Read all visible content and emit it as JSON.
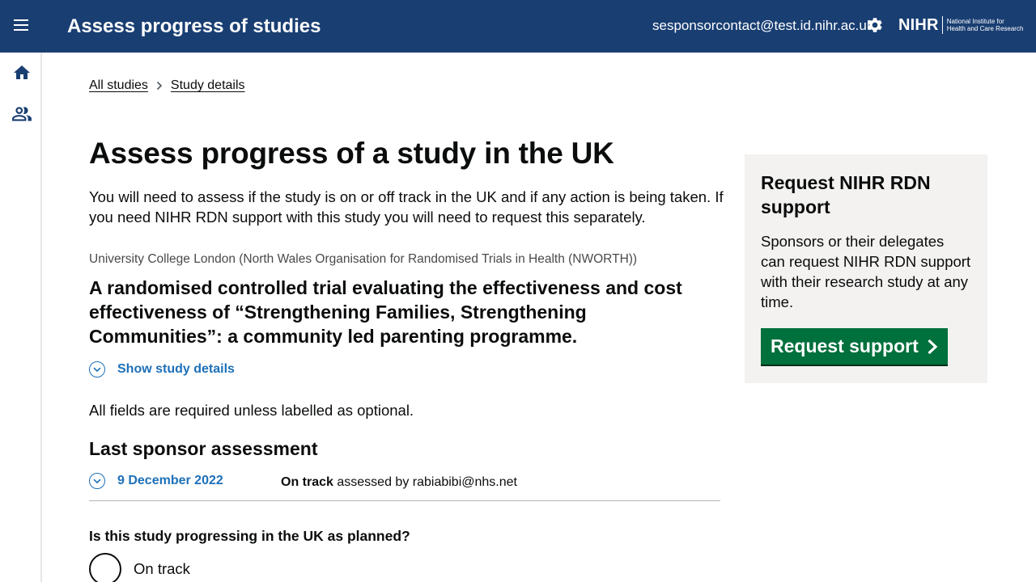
{
  "header": {
    "app_title": "Assess progress of studies",
    "user_email": "sesponsorcontact@test.id.nihr.ac.uk",
    "logo_mark": "NIHR",
    "logo_line1": "National Institute for",
    "logo_line2": "Health and Care Research",
    "background_color": "#193e72"
  },
  "sidenav": {
    "items": [
      {
        "icon": "home-icon"
      },
      {
        "icon": "people-icon"
      }
    ]
  },
  "breadcrumb": {
    "items": [
      "All studies",
      "Study details"
    ]
  },
  "main": {
    "title": "Assess progress of a study in the UK",
    "intro": "You will need to assess if the study is on or off track in the UK and if any action is being taken. If you need NIHR RDN support with this study you will need to request this separately.",
    "organisation": "University College London (North Wales Organisation for Randomised Trials in Health (NWORTH))",
    "study_title": "A randomised controlled trial evaluating the effectiveness and cost effectiveness of “Strengthening Families, Strengthening Communities”: a community led parenting programme.",
    "show_details_label": "Show study details",
    "required_note": "All fields are required unless labelled as optional.",
    "last_assessment_heading": "Last sponsor assessment",
    "last_assessment": {
      "date": "9 December 2022",
      "status": "On track",
      "assessed_by_text": "assessed by rabiabibi@nhs.net"
    },
    "question": "Is this study progressing in the UK as planned?",
    "options": [
      "On track"
    ]
  },
  "support_panel": {
    "heading": "Request NIHR RDN support",
    "text": "Sponsors or their delegates can request NIHR RDN support with their research study at any time.",
    "button_label": "Request support",
    "button_color": "#00703c"
  },
  "colors": {
    "link": "#1d70b8",
    "panel_bg": "#f3f2f1"
  }
}
